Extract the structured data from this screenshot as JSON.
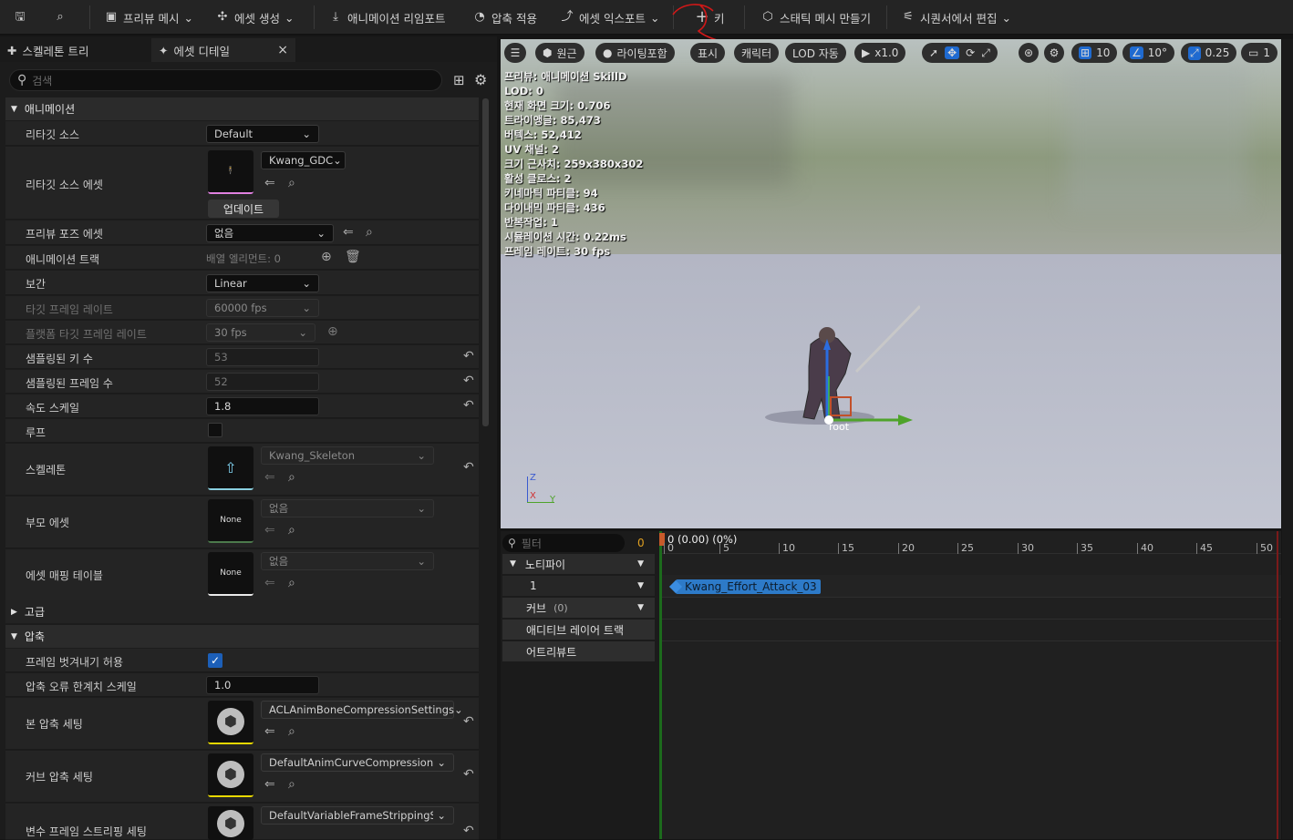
{
  "toolbar": {
    "preview_mesh": "프리뷰 메시",
    "create_asset": "에셋 생성",
    "reimport": "애니메이션 리임포트",
    "compress": "압축 적용",
    "export": "에셋 익스포트",
    "key": "키",
    "static_mesh": "스태틱 메시 만들기",
    "sequencer": "시퀀서에서 편집"
  },
  "tabs": {
    "skeleton_tree": "스켈레톤 트리",
    "asset_details": "에셋 디테일",
    "close": "×"
  },
  "details": {
    "search_placeholder": "검색",
    "cat_animation": "애니메이션",
    "retarget_source": {
      "label": "리타깃 소스",
      "value": "Default"
    },
    "retarget_asset": {
      "label": "리타깃 소스 에셋",
      "value": "Kwang_GDC",
      "update": "업데이트"
    },
    "preview_pose": {
      "label": "프리뷰 포즈 에셋",
      "value": "없음"
    },
    "anim_track": {
      "label": "애니메이션 트랙",
      "value": "배열 엘리먼트: 0"
    },
    "interp": {
      "label": "보간",
      "value": "Linear"
    },
    "target_fr": {
      "label": "타깃 프레임 레이트",
      "value": "60000 fps"
    },
    "platform_fr": {
      "label": "플랫폼 타깃 프레임 레이트",
      "value": "30 fps"
    },
    "sampled_keys": {
      "label": "샘플링된 키 수",
      "value": "53"
    },
    "sampled_frames": {
      "label": "샘플링된 프레임 수",
      "value": "52"
    },
    "rate_scale": {
      "label": "속도 스케일",
      "value": "1.8"
    },
    "loop": {
      "label": "루프"
    },
    "skeleton": {
      "label": "스켈레톤",
      "value": "Kwang_Skeleton"
    },
    "parent": {
      "label": "부모 에셋",
      "value": "없음",
      "thumb": "None"
    },
    "mapping": {
      "label": "에셋 매핑 테이블",
      "value": "없음",
      "thumb": "None"
    },
    "cat_advanced": "고급",
    "cat_compression": "압축",
    "allow_strip": {
      "label": "프레임 벗겨내기 허용"
    },
    "error_scale": {
      "label": "압축 오류 한계치 스케일",
      "value": "1.0"
    },
    "bone_comp": {
      "label": "본 압축 세팅",
      "value": "ACLAnimBoneCompressionSettings"
    },
    "curve_comp": {
      "label": "커브 압축 세팅",
      "value": "DefaultAnimCurveCompressionSett"
    },
    "var_strip": {
      "label": "변수 프레임 스트리핑 세팅",
      "value": "DefaultVariableFrameStrippingSetti"
    }
  },
  "viewport": {
    "perspective": "원근",
    "lit": "라이팅포함",
    "show": "표시",
    "character": "캐릭터",
    "lod": "LOD 자동",
    "speed": "x1.0",
    "grid": "10",
    "angle": "10°",
    "scale": "0.25",
    "cam": "1",
    "stats": [
      "프리뷰: 애니메이션 SkillD",
      "LOD: 0",
      "현재 화면 크기: 0.706",
      "트라이앵글: 85,473",
      "버텍스: 52,412",
      "UV 채널: 2",
      "크기 근사치: 259x380x302",
      "활성 클로스: 2",
      "키네마틱 파티클: 94",
      "다이내믹 파티클: 436",
      "반복작업: 1",
      "시뮬레이션 시간: 0.22ms",
      "프레임 레이트: 30 fps"
    ],
    "root_label": "root",
    "axis_z": "Z",
    "axis_x": "X",
    "axis_y": "Y"
  },
  "timeline": {
    "filter_placeholder": "필터",
    "count": "0",
    "notify": "노티파이",
    "track1": "1",
    "curves": "커브",
    "curves_count": "(0)",
    "additive": "애디티브 레이어 트랙",
    "attributes": "어트리뷰트",
    "position": "0 (0.00) (0%)",
    "ticks": [
      "0",
      "5",
      "10",
      "15",
      "20",
      "25",
      "30",
      "35",
      "40",
      "45",
      "50"
    ],
    "notify_event": "Kwang_Effort_Attack_03"
  }
}
